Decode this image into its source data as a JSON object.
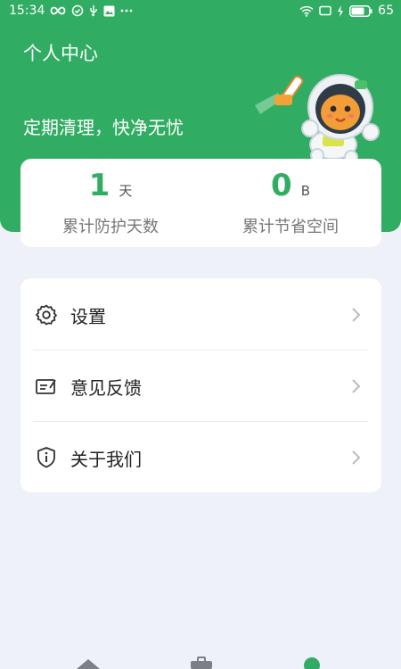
{
  "status_bar": {
    "time": "15:34",
    "battery_level": "65",
    "icons": [
      "infinity-icon",
      "check-circle-icon",
      "usb-icon",
      "image-icon",
      "more-icon",
      "wifi-icon",
      "screen-icon",
      "charging-icon",
      "battery-icon"
    ]
  },
  "header": {
    "title": "个人中心",
    "slogan": "定期清理，快净无忧"
  },
  "stats": {
    "protect_days": {
      "value": "1",
      "unit": "天",
      "label": "累计防护天数"
    },
    "saved_space": {
      "value": "0",
      "unit": "B",
      "label": "累计节省空间"
    }
  },
  "menu": {
    "items": [
      {
        "label": "设置",
        "icon": "gear-icon"
      },
      {
        "label": "意见反馈",
        "icon": "feedback-icon"
      },
      {
        "label": "关于我们",
        "icon": "shield-info-icon"
      }
    ]
  },
  "tabbar": {
    "icons": [
      "home-icon",
      "toolbox-icon",
      "profile-icon"
    ]
  },
  "colors": {
    "accent": "#31ad63",
    "background": "#eef1f7",
    "card": "#ffffff"
  }
}
